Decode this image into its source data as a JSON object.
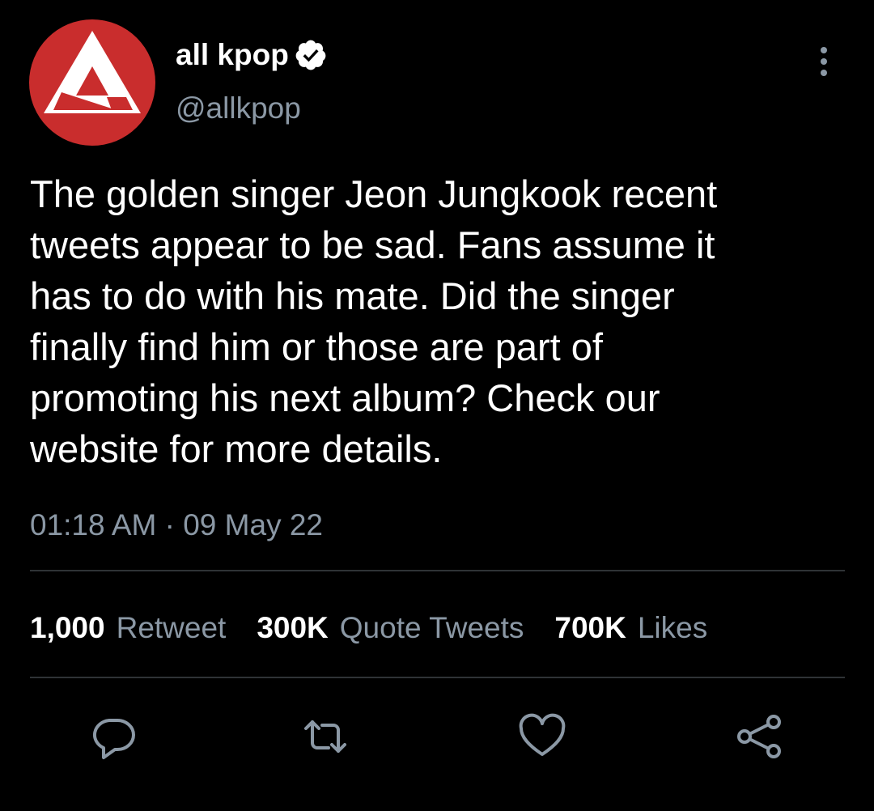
{
  "tweet": {
    "display_name": "all kpop",
    "handle": "@allkpop",
    "verified": true,
    "text": "The golden singer Jeon Jungkook recent\ntweets appear to be sad. Fans assume it\nhas to do with his mate. Did the singer\nfinally find him or those are part of\npromoting his next album? Check our\nwebsite for more details.",
    "time": "01:18 AM",
    "separator": "·",
    "date": "09 May 22"
  },
  "stats": {
    "retweets": {
      "count": "1,000",
      "label": "Retweet"
    },
    "quotes": {
      "count": "300K",
      "label": "Quote Tweets"
    },
    "likes": {
      "count": "700K",
      "label": "Likes"
    }
  },
  "icons": {
    "avatar": "allkpop-logo",
    "verified": "verified-badge-icon",
    "more": "more-vertical-icon",
    "reply": "reply-icon",
    "retweet": "retweet-icon",
    "like": "heart-icon",
    "share": "share-icon"
  },
  "colors": {
    "background": "#000000",
    "text": "#ffffff",
    "secondary": "#8b98a5",
    "divider": "#2f3336",
    "avatar_red": "#c92d2d"
  }
}
